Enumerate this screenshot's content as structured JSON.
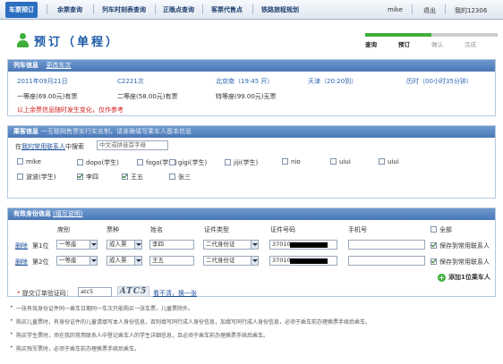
{
  "nav": {
    "items": [
      "车票预订",
      "余票查询",
      "列车时刻表查询",
      "正晚点查询",
      "客票代售点",
      "铁路旅程规划"
    ],
    "user": "mike",
    "logout": "退出",
    "mine": "我的12306"
  },
  "page": {
    "title": "预订（单程）"
  },
  "steps": [
    {
      "label": "查询",
      "done": true
    },
    {
      "label": "预订",
      "done": true
    },
    {
      "label": "确认",
      "done": false
    },
    {
      "label": "完成",
      "done": false
    }
  ],
  "train": {
    "header": "列车信息",
    "change_link": "更改车次",
    "date": "2011年09月21日",
    "train_no": "C2221次",
    "depart": "北京南（19:45 开）",
    "arrive": "天津（20:20到）",
    "duration": "历时（00小时35分钟）",
    "seats": [
      "一等座(69.00元)有票",
      "二等座(58.00元)有票",
      "特等座(99.00元)无票"
    ],
    "note": "以上余票信息随时发生变化，仅作参考"
  },
  "contacts": {
    "header": "乘客信息",
    "header_sub": "一互联网售票实行实名制，请准确填写乘车人基本信息",
    "search_prefix": "在",
    "search_link": "我的常用联系人",
    "search_suffix": "中搜索",
    "search_placeholder": "中文或拼音首字母",
    "people": [
      {
        "name": "mike",
        "checked": false
      },
      {
        "name": "dopo(学生)",
        "checked": false
      },
      {
        "name": "fogo(学生)",
        "checked": false
      },
      {
        "name": "gigi(学生)",
        "checked": false
      },
      {
        "name": "jiji(学生)",
        "checked": false
      },
      {
        "name": "nio",
        "checked": false
      },
      {
        "name": "uiui",
        "checked": false
      },
      {
        "name": "uiui",
        "checked": false
      },
      {
        "name": "波波(学生)",
        "checked": false
      },
      {
        "name": "李四",
        "checked": true
      },
      {
        "name": "王五",
        "checked": true
      },
      {
        "name": "张三",
        "checked": false
      }
    ]
  },
  "identity": {
    "header": "有效身份信息",
    "header_link": "(填写说明)",
    "columns": [
      "席别",
      "票种",
      "姓名",
      "证件类型",
      "证件号码",
      "手机号"
    ],
    "all_label": "全部",
    "rows": [
      {
        "del": "删除",
        "pos": "第1位",
        "seat": "一等座",
        "type": "成人票",
        "name": "李四",
        "id_type": "二代身份证",
        "id_no": "37010",
        "phone": "",
        "save": "保存到常用联系人",
        "save_checked": true
      },
      {
        "del": "删除",
        "pos": "第2位",
        "seat": "一等座",
        "type": "成人票",
        "name": "王五",
        "id_type": "二代身份证",
        "id_no": "37010",
        "phone": "",
        "save": "保存到常用联系人",
        "save_checked": true
      }
    ],
    "add_label": "添加1位乘车人",
    "captcha_label": "提交订单验证码：",
    "captcha_value": "atc5",
    "captcha_image": "ATC5",
    "captcha_refresh": "看不清，换一张"
  },
  "notes": [
    "一张有效身份证件同一乘车日期同一车次只能购买一张车票，儿童票除外。",
    "购买儿童票时，有身份证件的儿童请填写本人身份信息，否则填写同行成人身份信息，加填写同行成人身份信息，必须于乘车前办理换票手续后乘车。",
    "购买学生票时，须在我的常用联系人中登记乘车人的学生详细信息，且必须于乘车前办理换票手续后乘车。",
    "购买残军票时，必须于乘车前办理换票手续后乘车。"
  ],
  "colors": {
    "header_blue": "#4a78b6",
    "accent_green": "#3fae3a",
    "warning_red": "#d21d1d"
  }
}
